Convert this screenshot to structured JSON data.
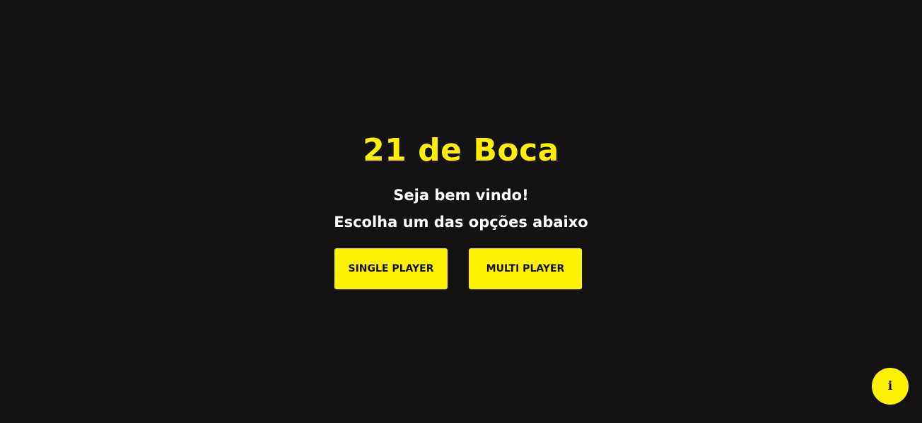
{
  "header": {
    "title": "21 de Boca"
  },
  "welcome": {
    "line1": "Seja bem vindo!",
    "line2": "Escolha um das opções abaixo"
  },
  "options": {
    "single_player_label": "SINGLE PLAYER",
    "multi_player_label": "MULTI PLAYER"
  },
  "info_button": {
    "icon": "info-icon",
    "glyph": "i"
  },
  "colors": {
    "background": "#141213",
    "accent": "#fff200",
    "title": "#ffef00",
    "text": "#ffffff"
  }
}
